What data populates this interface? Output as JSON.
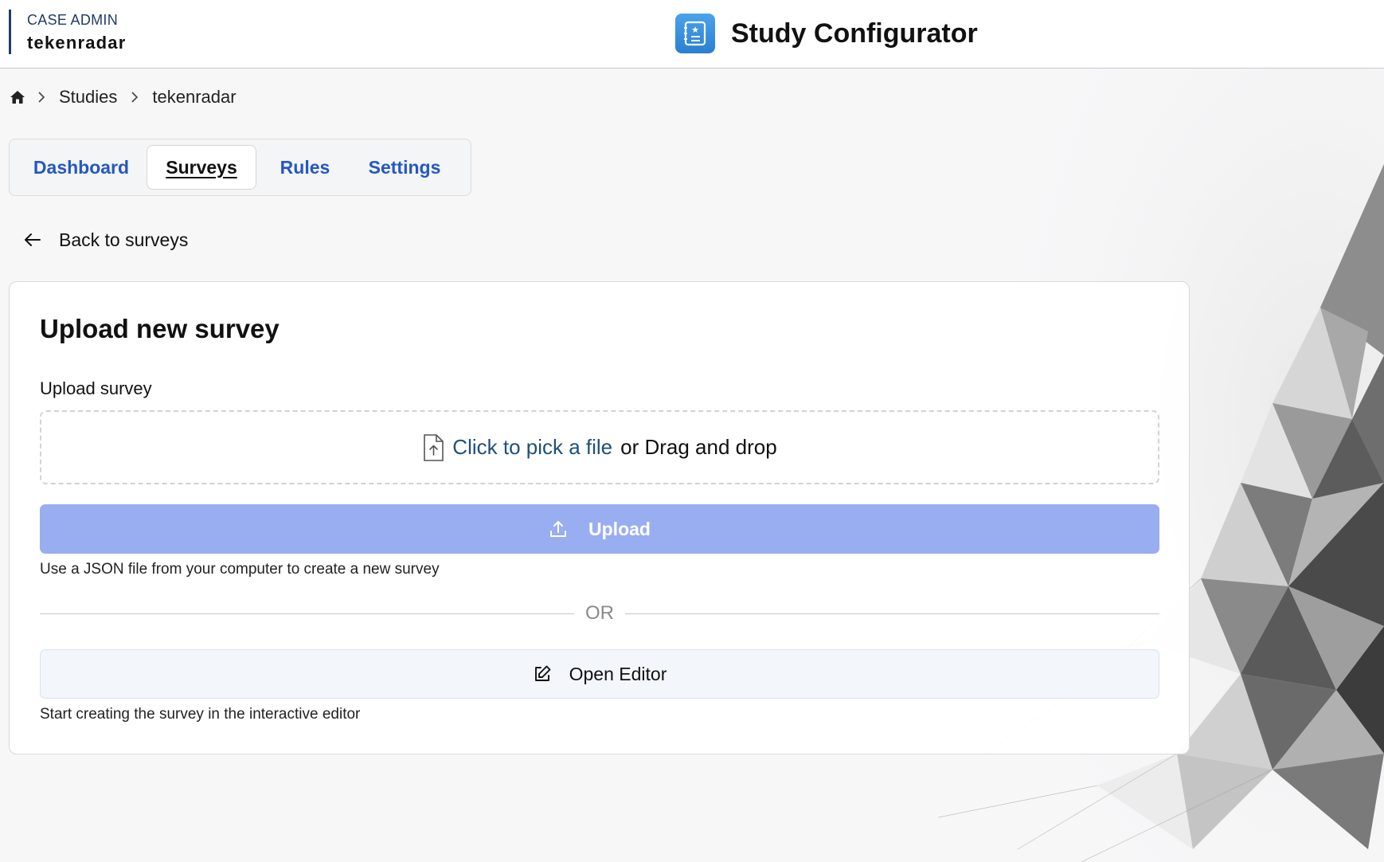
{
  "header": {
    "org_label": "CASE ADMIN",
    "org_name": "tekenradar",
    "app_title": "Study Configurator",
    "app_icon": "clipboard-list-icon",
    "accent_color": "#2a7fd1"
  },
  "breadcrumb": {
    "home_icon": "home-icon",
    "items": [
      "Studies",
      "tekenradar"
    ]
  },
  "tabs": [
    {
      "label": "Dashboard",
      "active": false
    },
    {
      "label": "Surveys",
      "active": true
    },
    {
      "label": "Rules",
      "active": false
    },
    {
      "label": "Settings",
      "active": false
    }
  ],
  "back_link": {
    "label": "Back to surveys",
    "icon": "arrow-left-icon"
  },
  "card": {
    "title": "Upload new survey",
    "field_label": "Upload survey",
    "dropzone": {
      "icon": "file-upload-icon",
      "link_text": "Click to pick a file",
      "rest_text": "or Drag and drop"
    },
    "upload_button": {
      "label": "Upload",
      "icon": "upload-icon",
      "color": "#99aef0"
    },
    "upload_hint": "Use a JSON file from your computer to create a new survey",
    "divider_text": "OR",
    "editor_button": {
      "label": "Open Editor",
      "icon": "edit-icon"
    },
    "editor_hint": "Start creating the survey in the interactive editor"
  }
}
